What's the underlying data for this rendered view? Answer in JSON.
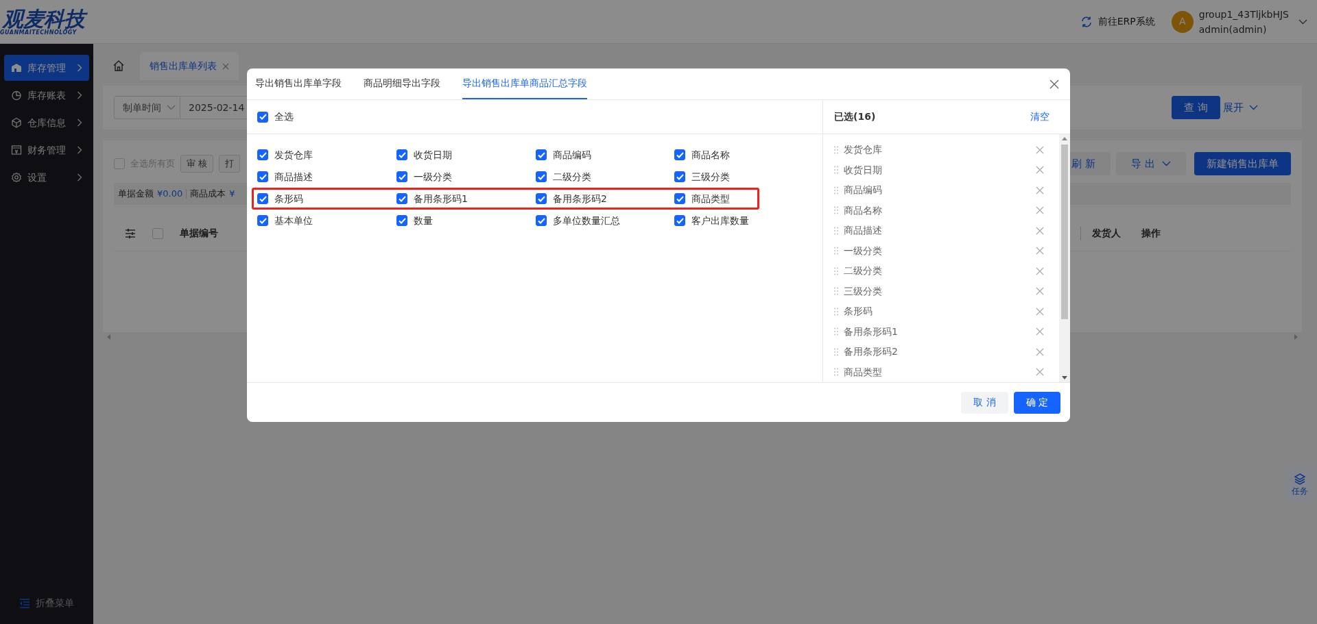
{
  "header": {
    "logo_title": "观麦科技",
    "logo_subtitle": "GUANMAITECHNOLOGY",
    "erp_link": "前往ERP系统",
    "avatar_letter": "A",
    "user_name": "group1_43TljkbHJS",
    "user_role": "admin(admin)"
  },
  "sidebar": {
    "items": [
      {
        "label": "库存管理",
        "selected": true
      },
      {
        "label": "库存账表",
        "selected": false
      },
      {
        "label": "仓库信息",
        "selected": false
      },
      {
        "label": "财务管理",
        "selected": false
      },
      {
        "label": "设置",
        "selected": false
      }
    ],
    "collapse_label": "折叠菜单"
  },
  "page_tabs": [
    {
      "label": "销售出库单列表",
      "selected": true
    }
  ],
  "filter": {
    "date_type": "制单时间",
    "date_value": "2025-02-14",
    "query_button": "查 询",
    "expand_label": "展开"
  },
  "toolbar": {
    "select_all_pages": {
      "label": "全选所有页",
      "checked": false
    },
    "left_buttons": [
      "审 核",
      "打"
    ],
    "refresh_button": "刷 新",
    "export_button": "导 出",
    "create_button": "新建销售出库单"
  },
  "summary": [
    {
      "label": "单据金额",
      "value": "¥0.00"
    },
    {
      "label": "商品成本",
      "value": "¥"
    }
  ],
  "table": {
    "header_checked": false,
    "left_columns": [
      "单据编号"
    ],
    "right_columns": [
      "发货人",
      "操作"
    ]
  },
  "task_button": "任务",
  "modal": {
    "tabs": [
      {
        "label": "导出销售出库单字段",
        "selected": false
      },
      {
        "label": "商品明细导出字段",
        "selected": false
      },
      {
        "label": "导出销售出库单商品汇总字段",
        "selected": true
      }
    ],
    "select_all": {
      "label": "全选",
      "checked": true
    },
    "field_rows": [
      {
        "highlighted": false,
        "fields": [
          {
            "label": "发货仓库",
            "checked": true
          },
          {
            "label": "收货日期",
            "checked": true
          },
          {
            "label": "商品编码",
            "checked": true
          },
          {
            "label": "商品名称",
            "checked": true
          }
        ]
      },
      {
        "highlighted": false,
        "fields": [
          {
            "label": "商品描述",
            "checked": true
          },
          {
            "label": "一级分类",
            "checked": true
          },
          {
            "label": "二级分类",
            "checked": true
          },
          {
            "label": "三级分类",
            "checked": true
          }
        ]
      },
      {
        "highlighted": true,
        "fields": [
          {
            "label": "条形码",
            "checked": true
          },
          {
            "label": "备用条形码1",
            "checked": true
          },
          {
            "label": "备用条形码2",
            "checked": true
          },
          {
            "label": "商品类型",
            "checked": true
          }
        ]
      },
      {
        "highlighted": false,
        "fields": [
          {
            "label": "基本单位",
            "checked": true
          },
          {
            "label": "数量",
            "checked": true
          },
          {
            "label": "多单位数量汇总",
            "checked": true
          },
          {
            "label": "客户出库数量",
            "checked": true
          }
        ]
      }
    ],
    "selected_title": "已选(16)",
    "clear_label": "清空",
    "selected_items": [
      "发货仓库",
      "收货日期",
      "商品编码",
      "商品名称",
      "商品描述",
      "一级分类",
      "二级分类",
      "三级分类",
      "条形码",
      "备用条形码1",
      "备用条形码2",
      "商品类型"
    ],
    "cancel_button": "取 消",
    "ok_button": "确 定"
  }
}
